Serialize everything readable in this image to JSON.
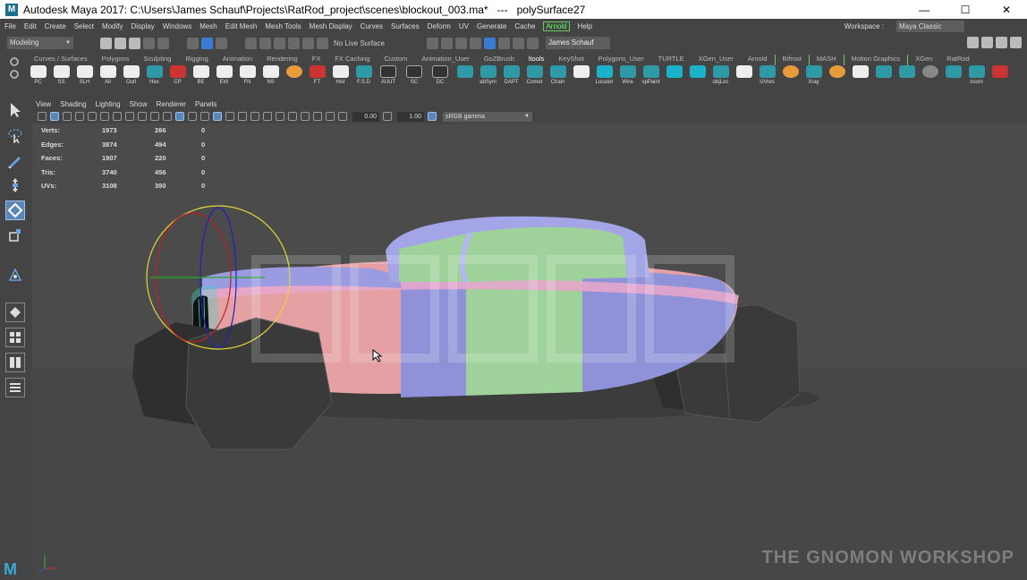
{
  "window": {
    "title": "Autodesk Maya 2017: C:\\Users\\James Schauf\\Projects\\RatRod_project\\scenes\\blockout_003.ma*   ---   polySurface27",
    "controls": [
      "—",
      "☐",
      "✕"
    ]
  },
  "menu": {
    "items": [
      "File",
      "Edit",
      "Create",
      "Select",
      "Modify",
      "Display",
      "Windows",
      "Mesh",
      "Edit Mesh",
      "Mesh Tools",
      "Mesh Display",
      "Curves",
      "Surfaces",
      "Deform",
      "UV",
      "Generate",
      "Cache"
    ],
    "arnold": "Arnold",
    "help": "Help",
    "workspace_label": "Workspace :",
    "workspace_value": "Maya Classic"
  },
  "status": {
    "mode": "Modeling",
    "live_surface": "No Live Surface",
    "user": "James Schauf"
  },
  "shelf": {
    "tabs": [
      "Curves / Surfaces",
      "Polygons",
      "Sculpting",
      "Rigging",
      "Animation",
      "Rendering",
      "FX",
      "FX Caching",
      "Custom",
      "Animation_User",
      "GoZBrush",
      "ltools",
      "KeyShot",
      "Polygons_User",
      "TURTLE",
      "XGen_User",
      "Arnold",
      "Bifrost",
      "MASH",
      "Motion Graphics",
      "XGen",
      "RatRod"
    ],
    "active_tab": "ltools",
    "items": [
      {
        "label": "PC",
        "style": "white"
      },
      {
        "label": "SS",
        "style": "white"
      },
      {
        "label": "SLH",
        "style": "white"
      },
      {
        "label": "All",
        "style": "white"
      },
      {
        "label": "Outl",
        "style": "white"
      },
      {
        "label": "Hex",
        "style": "teal"
      },
      {
        "label": "CP",
        "style": "red"
      },
      {
        "label": "BE",
        "style": "white"
      },
      {
        "label": "EW",
        "style": "white"
      },
      {
        "label": "FN",
        "style": "white"
      },
      {
        "label": "NS",
        "style": "white"
      },
      {
        "label": "",
        "style": "orange"
      },
      {
        "label": "FT",
        "style": "red"
      },
      {
        "label": "Hist",
        "style": "white"
      },
      {
        "label": "F.S.D",
        "style": "teal"
      },
      {
        "label": "AUUT",
        "style": "dark"
      },
      {
        "label": "SC",
        "style": "dark"
      },
      {
        "label": "DC",
        "style": "dark"
      },
      {
        "label": "",
        "style": "teal"
      },
      {
        "label": "abSym",
        "style": "teal"
      },
      {
        "label": "DAPT",
        "style": "teal"
      },
      {
        "label": "Comet",
        "style": "teal"
      },
      {
        "label": "Chain",
        "style": "teal"
      },
      {
        "label": "",
        "style": "white"
      },
      {
        "label": "Locator",
        "style": "cyan"
      },
      {
        "label": "Wire",
        "style": "teal"
      },
      {
        "label": "spPaint",
        "style": "teal"
      },
      {
        "label": "",
        "style": "cyan"
      },
      {
        "label": "",
        "style": "cyan"
      },
      {
        "label": "objLoc",
        "style": "teal"
      },
      {
        "label": "",
        "style": "white"
      },
      {
        "label": "UVres",
        "style": "teal"
      },
      {
        "label": "",
        "style": "orange"
      },
      {
        "label": "Xray",
        "style": "teal"
      },
      {
        "label": "",
        "style": "orange"
      },
      {
        "label": "",
        "style": "white"
      },
      {
        "label": "",
        "style": "teal"
      },
      {
        "label": "",
        "style": "teal"
      },
      {
        "label": "",
        "style": "grey"
      },
      {
        "label": "",
        "style": "teal"
      },
      {
        "label": "zoom",
        "style": "teal"
      },
      {
        "label": "",
        "style": "red"
      }
    ]
  },
  "viewport": {
    "menu": [
      "View",
      "Shading",
      "Lighting",
      "Show",
      "Renderer",
      "Panels"
    ],
    "exposure": "0.00",
    "gamma_value": "1.00",
    "color_space": "sRGB gamma",
    "hud": [
      {
        "label": "Verts:",
        "a": "1973",
        "b": "266",
        "c": "0"
      },
      {
        "label": "Edges:",
        "a": "3874",
        "b": "494",
        "c": "0"
      },
      {
        "label": "Faces:",
        "a": "1907",
        "b": "220",
        "c": "0"
      },
      {
        "label": "Tris:",
        "a": "3740",
        "b": "456",
        "c": "0"
      },
      {
        "label": "UVs:",
        "a": "3108",
        "b": "390",
        "c": "0"
      }
    ],
    "watermark_brand": "THE GNOMON WORKSHOP"
  },
  "colors": {
    "accent": "#5c86b8",
    "arnold": "#66cc66",
    "background": "#444444",
    "viewport": "#4b4b4b",
    "body_pink": "#e7a3a6",
    "body_blue": "#8f92d8",
    "body_green": "#9fd19a",
    "wheel": "#3a3a3a"
  }
}
